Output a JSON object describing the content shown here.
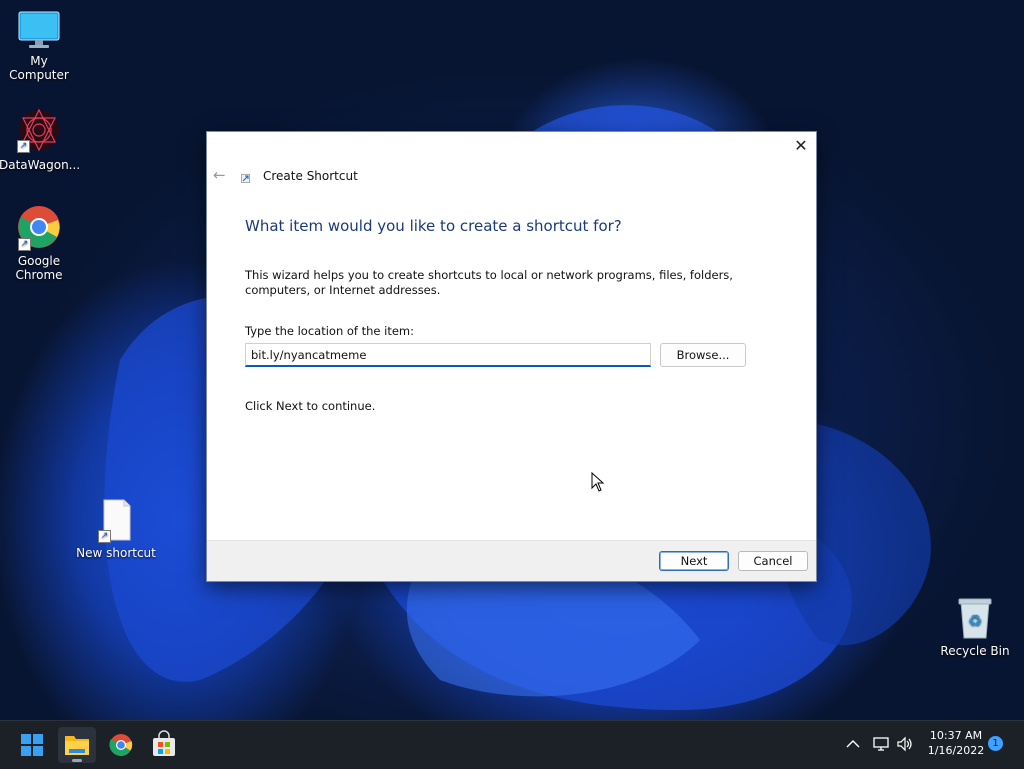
{
  "desktop": {
    "icons": [
      {
        "label": "My Computer"
      },
      {
        "label": "DataWagon..."
      },
      {
        "label_line1": "Google",
        "label_line2": "Chrome"
      },
      {
        "label": "New shortcut"
      },
      {
        "label": "Recycle Bin"
      }
    ]
  },
  "dialog": {
    "title": "Create Shortcut",
    "heading": "What item would you like to create a shortcut for?",
    "description": "This wizard helps you to create shortcuts to local or network programs, files, folders, computers, or Internet addresses.",
    "location_label": "Type the location of the item:",
    "location_value": "bit.ly/nyancatmeme",
    "browse_label": "Browse...",
    "hint": "Click Next to continue.",
    "next_label": "Next",
    "cancel_label": "Cancel",
    "close_glyph": "✕",
    "back_glyph": "←"
  },
  "taskbar": {
    "time": "10:37 AM",
    "date": "1/16/2022",
    "notification_count": "1",
    "icons": [
      "windows-start-icon",
      "file-explorer-icon",
      "chrome-icon",
      "microsoft-store-icon"
    ],
    "tray_icons": [
      "chevron-up-icon",
      "network-icon",
      "volume-icon"
    ]
  },
  "colors": {
    "heading": "#1b3a7a",
    "accent": "#0a5bb5",
    "taskbar": "#1c2128"
  }
}
